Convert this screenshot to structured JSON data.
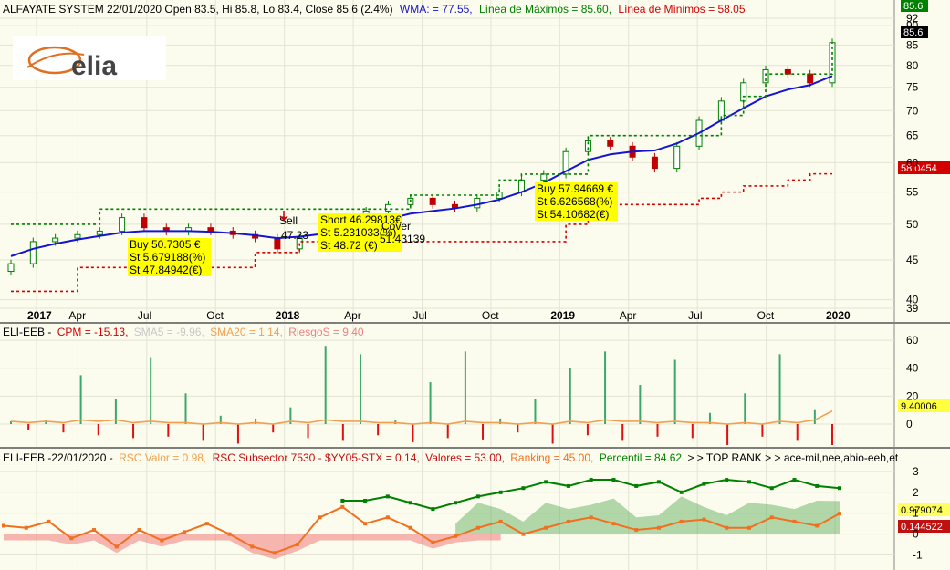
{
  "panel1": {
    "header": {
      "title": "ALFAYATE SYSTEM 22/01/2020 Open 83.5, Hi 85.8, Lo 83.4, Close 85.6 (2.4%)",
      "wma": "WMA:  = 77.55,",
      "max": "Línea de Máximos = 85.60,",
      "min": "Línea de Mínimos = 58.05"
    },
    "logo_text": "elia",
    "price_badges": [
      "85.6",
      "85.6"
    ],
    "min_badge": "58.0454",
    "y_ticks": [
      "92",
      "90",
      "85",
      "80",
      "75",
      "70",
      "65",
      "60",
      "55",
      "50",
      "45",
      "40",
      "39"
    ],
    "x_ticks": [
      "2017",
      "Apr",
      "Jul",
      "Oct",
      "2018",
      "Apr",
      "Jul",
      "Oct",
      "2019",
      "Apr",
      "Jul",
      "Oct",
      "2020"
    ],
    "annotations": {
      "buy1": [
        "Buy 50.7305 €",
        "St 5.679188(%)",
        "St 47.84942(€)"
      ],
      "sell": "Sell",
      "sell_price": "47.23",
      "short": [
        "Short 46.29813€",
        "St 5.231033(%)",
        "St 48.72 (€)"
      ],
      "cover": "Cover",
      "cover_price": "51.43139",
      "buy2": [
        "Buy 57.94669 €",
        "St 6.626568(%)",
        "St 54.10682(€)"
      ]
    }
  },
  "panel2": {
    "header": {
      "prefix": "ELI-EEB -",
      "cpm": "CPM = -15.13,",
      "sma5": "SMA5 = -9.96,",
      "sma20": "SMA20 = 1.14,",
      "riesgo": "RiesgoS = 9.40"
    },
    "badge": "9.40006",
    "y_ticks": [
      "60",
      "40",
      "20",
      "0"
    ]
  },
  "panel3": {
    "header": {
      "prefix": "ELI-EEB -22/01/2020 -",
      "rsc_valor": "RSC Valor = 0.98,",
      "rsc_sub": "RSC Subsector 7530 - $YY05-STX = 0.14,",
      "valores": "Valores = 53.00,",
      "ranking": "Ranking = 45.00,",
      "percentil": "Percentil = 84.62",
      "top": "> > TOP RANK > > ace-mil,nee,abio-eeb,et"
    },
    "badge1": "0.979074",
    "badge2": "0.144522",
    "y_ticks": [
      "3",
      "2",
      "1",
      "0",
      "-1"
    ]
  },
  "colors": {
    "wma": "#1414d2",
    "max_line": "#008000",
    "min_line": "#d40000",
    "up_candle": "#008000",
    "down_candle": "#c00000",
    "cpm_up": "#3aa86a",
    "cpm_down": "#e01010",
    "sma20": "#f0a050",
    "rank_green": "#008000",
    "rsc_orange": "#f07020",
    "annot_bg": "#ffff00"
  },
  "chart_data": [
    {
      "type": "candlestick",
      "title": "ALFAYATE SYSTEM",
      "x_range": [
        "2016-12",
        "2020-01"
      ],
      "ylim": [
        39,
        92
      ],
      "series": [
        {
          "name": "Close",
          "x": [
            "2016-12",
            "2017-01",
            "2017-02",
            "2017-03",
            "2017-04",
            "2017-05",
            "2017-06",
            "2017-07",
            "2017-08",
            "2017-09",
            "2017-10",
            "2017-11",
            "2017-12",
            "2018-01",
            "2018-02",
            "2018-03",
            "2018-04",
            "2018-05",
            "2018-06",
            "2018-07",
            "2018-08",
            "2018-09",
            "2018-10",
            "2018-11",
            "2018-12",
            "2019-01",
            "2019-02",
            "2019-03",
            "2019-04",
            "2019-05",
            "2019-06",
            "2019-07",
            "2019-08",
            "2019-09",
            "2019-10",
            "2019-11",
            "2019-12",
            "2020-01"
          ],
          "values": [
            44.5,
            47.5,
            48,
            48.5,
            49,
            51,
            49.5,
            49,
            49.5,
            49,
            48.5,
            48,
            46.5,
            48,
            49,
            50.5,
            52,
            53,
            54,
            53,
            52.5,
            54,
            55,
            57,
            58,
            62,
            64,
            63,
            61,
            59,
            63,
            68,
            72,
            76,
            79,
            78,
            76,
            85.6
          ]
        },
        {
          "name": "WMA",
          "values": [
            45.5,
            46.5,
            47.2,
            47.8,
            48.3,
            48.8,
            49.0,
            49.0,
            49.0,
            48.9,
            48.7,
            48.4,
            48.0,
            48.2,
            48.6,
            49.2,
            50.0,
            50.8,
            51.6,
            52.0,
            52.4,
            53.0,
            53.8,
            55.0,
            56.5,
            58.5,
            60.5,
            61.5,
            62.0,
            62.2,
            63.5,
            65.5,
            68.0,
            70.5,
            73.0,
            74.5,
            75.5,
            77.55
          ]
        },
        {
          "name": "Línea de Máximos",
          "values": [
            50,
            50,
            50,
            50,
            52.3,
            52.3,
            52.3,
            52.3,
            52.3,
            52.3,
            52.3,
            52.3,
            52.3,
            52.3,
            52.3,
            52.3,
            52.3,
            52.3,
            54.5,
            54.5,
            54.5,
            54.5,
            57,
            58,
            58,
            58,
            65,
            65,
            65,
            65,
            65,
            65,
            69,
            73,
            78,
            78,
            78,
            85.6
          ]
        },
        {
          "name": "Línea de Mínimos",
          "values": [
            41,
            41,
            41,
            44,
            44,
            44,
            44,
            44,
            44,
            44,
            44,
            46,
            46,
            47.5,
            47.5,
            47.5,
            47.5,
            47.5,
            47.5,
            47.5,
            47.5,
            47.5,
            47.5,
            47.5,
            47.5,
            50,
            52,
            53,
            53,
            53,
            53,
            54,
            55,
            56,
            56,
            57,
            58.05,
            58.05
          ]
        }
      ]
    },
    {
      "type": "bar",
      "title": "ELI-EEB - CPM",
      "ylim": [
        -15,
        62
      ],
      "series": [
        {
          "name": "CPM",
          "values": [
            2,
            -4,
            3,
            -6,
            35,
            -8,
            18,
            -10,
            48,
            -9,
            22,
            -12,
            6,
            -14,
            4,
            -6,
            12,
            -10,
            56,
            -12,
            50,
            -8,
            3,
            -13,
            30,
            -10,
            52,
            -11,
            4,
            -6,
            18,
            -14,
            40,
            -8,
            52,
            -12,
            28,
            -9,
            46,
            -10,
            8,
            -15,
            22,
            -9,
            50,
            -12,
            10,
            -15
          ]
        },
        {
          "name": "SMA20",
          "values": [
            2,
            1,
            2,
            1,
            3,
            2,
            3,
            1,
            2,
            1,
            1,
            0,
            1,
            0,
            1,
            0,
            2,
            1,
            3,
            2,
            2,
            1,
            1,
            0,
            1,
            0,
            2,
            1,
            1,
            0,
            1,
            0,
            2,
            1,
            3,
            2,
            2,
            1,
            2,
            1,
            1,
            0,
            1,
            0,
            2,
            1,
            3,
            9.4
          ]
        }
      ]
    },
    {
      "type": "line",
      "title": "ELI-EEB RSC",
      "ylim": [
        -1.5,
        3.3
      ],
      "series": [
        {
          "name": "RSC Valor",
          "values": [
            0.4,
            0.3,
            0.6,
            -0.2,
            0.2,
            -0.6,
            0.2,
            -0.3,
            0.1,
            0.5,
            0.0,
            -0.6,
            -0.9,
            -0.5,
            0.8,
            1.3,
            0.5,
            0.8,
            0.3,
            -0.4,
            -0.1,
            0.3,
            0.6,
            0.0,
            0.3,
            0.6,
            0.8,
            0.5,
            0.2,
            0.3,
            0.6,
            0.7,
            0.3,
            0.3,
            0.8,
            0.6,
            0.4,
            0.98
          ]
        },
        {
          "name": "Ranking",
          "values": [
            null,
            null,
            null,
            null,
            null,
            null,
            null,
            null,
            null,
            null,
            null,
            null,
            null,
            null,
            null,
            1.6,
            1.6,
            1.8,
            1.5,
            1.2,
            1.5,
            1.8,
            2.0,
            2.2,
            2.5,
            2.3,
            2.6,
            2.6,
            2.3,
            2.5,
            2.0,
            2.4,
            2.6,
            2.5,
            2.2,
            2.6,
            2.3,
            2.2
          ]
        }
      ]
    }
  ]
}
